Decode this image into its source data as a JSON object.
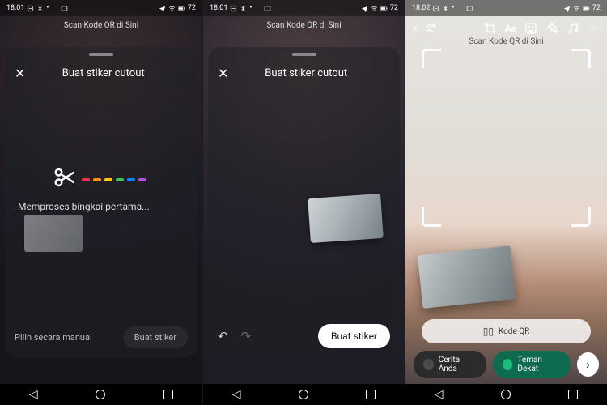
{
  "status": {
    "time_a": "18:01",
    "time_b": "18:01",
    "time_c": "18:02",
    "battery": "72"
  },
  "banner": {
    "qr_scan": "Scan Kode QR di Sini"
  },
  "sheet": {
    "title": "Buat stiker cutout",
    "processing": "Memproses bingkai pertama...",
    "manual_pick": "Pilih secara manual",
    "make_sticker": "Buat stiker",
    "dash_colors": [
      "#ff2d55",
      "#ff9500",
      "#ffcc00",
      "#34c759",
      "#0a84ff",
      "#af52de"
    ]
  },
  "screen3": {
    "qr_label": "Kode QR",
    "share_your_story": "Cerita Anda",
    "close_friends": "Teman Dekat"
  }
}
